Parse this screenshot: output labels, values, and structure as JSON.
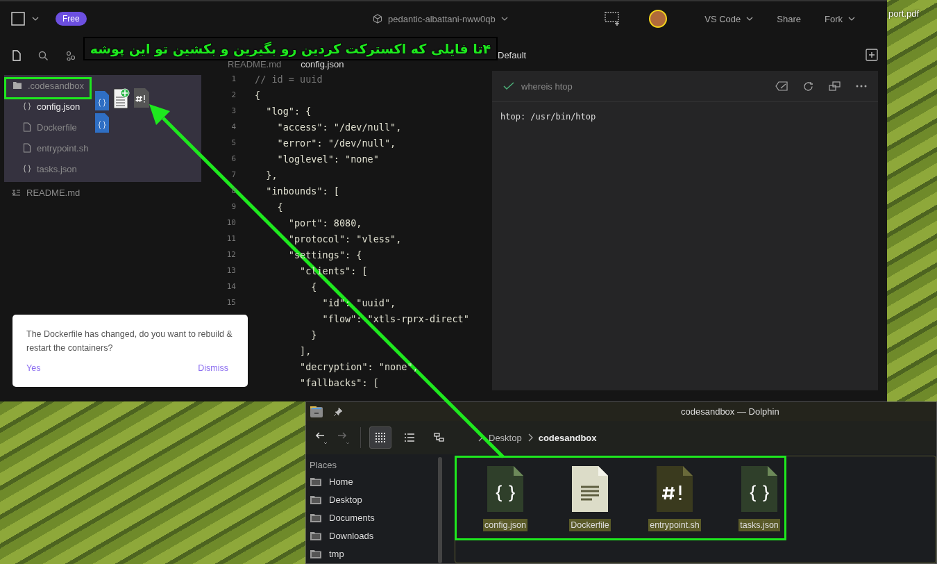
{
  "desktop": {
    "file_label": "port.pdf"
  },
  "ide": {
    "topbar": {
      "plan_badge": "Free",
      "project": "pedantic-albattani-nww0qb",
      "editor_menu": "VS Code",
      "share": "Share",
      "fork": "Fork"
    },
    "tabs": [
      {
        "label": "README.md",
        "selected": false
      },
      {
        "label": "config.json",
        "selected": true
      }
    ],
    "file_tree": [
      {
        "name": ".codesandbox",
        "kind": "folder",
        "expanded": true,
        "selected": false,
        "children": [
          {
            "name": "config.json",
            "kind": "json",
            "selected": true
          },
          {
            "name": "Dockerfile",
            "kind": "file",
            "selected": false
          },
          {
            "name": "entrypoint.sh",
            "kind": "file",
            "selected": false
          },
          {
            "name": "tasks.json",
            "kind": "json",
            "selected": false
          }
        ]
      },
      {
        "name": "README.md",
        "kind": "markdown",
        "selected": false
      }
    ],
    "code_lines": [
      {
        "number": "1",
        "kind": "comment",
        "text": "// id = uuid"
      },
      {
        "number": "2",
        "kind": "code",
        "text": "{"
      },
      {
        "number": "3",
        "kind": "code",
        "text": "  \"log\": {"
      },
      {
        "number": "4",
        "kind": "code",
        "text": "    \"access\": \"/dev/null\","
      },
      {
        "number": "5",
        "kind": "code",
        "text": "    \"error\": \"/dev/null\","
      },
      {
        "number": "6",
        "kind": "code",
        "text": "    \"loglevel\": \"none\""
      },
      {
        "number": "7",
        "kind": "code",
        "text": "  },"
      },
      {
        "number": "8",
        "kind": "code",
        "text": "  \"inbounds\": ["
      },
      {
        "number": "9",
        "kind": "code",
        "text": "    {"
      },
      {
        "number": "10",
        "kind": "code",
        "text": "      \"port\": 8080,"
      },
      {
        "number": "11",
        "kind": "code",
        "text": "      \"protocol\": \"vless\","
      },
      {
        "number": "12",
        "kind": "code",
        "text": "      \"settings\": {"
      },
      {
        "number": "13",
        "kind": "code",
        "text": "        \"clients\": ["
      },
      {
        "number": "14",
        "kind": "code",
        "text": "          {"
      },
      {
        "number": "15",
        "kind": "code",
        "text": "            \"id\": \"uuid\","
      },
      {
        "kind": "code",
        "text": "            \"flow\": \"xtls-rprx-direct\""
      },
      {
        "kind": "code",
        "text": "          }"
      },
      {
        "kind": "code",
        "text": "        ],"
      },
      {
        "kind": "code",
        "text": "        \"decryption\": \"none\","
      },
      {
        "kind": "code",
        "text": "        \"fallbacks\": ["
      }
    ],
    "terminal": {
      "tab": "Default",
      "command": "whereis htop",
      "output": "htop: /usr/bin/htop"
    },
    "notification": {
      "message": "The Dockerfile has changed, do you want to rebuild & restart the containers?",
      "actions": [
        "Yes",
        "Dismiss"
      ]
    }
  },
  "dolphin": {
    "title": "codesandbox — Dolphin",
    "breadcrumb": [
      "Desktop",
      "codesandbox"
    ],
    "view_modes": [
      {
        "kind": "icons",
        "selected": true
      },
      {
        "kind": "details",
        "selected": false
      },
      {
        "kind": "tree",
        "selected": false
      }
    ],
    "places_heading": "Places",
    "places": [
      "Home",
      "Desktop",
      "Documents",
      "Downloads",
      "tmp"
    ],
    "files": [
      {
        "name": "config.json",
        "kind": "json",
        "selected": true
      },
      {
        "name": "Dockerfile",
        "kind": "text",
        "selected": true
      },
      {
        "name": "entrypoint.sh",
        "kind": "script",
        "selected": true
      },
      {
        "name": "tasks.json",
        "kind": "json",
        "selected": true
      }
    ]
  },
  "annotation": {
    "text": "۴تا فایلی که اکسترکت کردین رو بگیرین و بکشین تو این پوشه"
  }
}
